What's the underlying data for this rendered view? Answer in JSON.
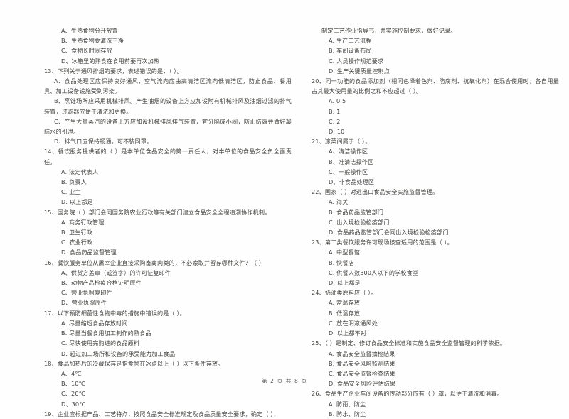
{
  "document": {
    "type": "scanned-exam-paper",
    "language": "zh-CN",
    "footer": "第 2 页 共 8 页",
    "page_number": 2,
    "total_pages": 8,
    "background_color": "#fefefe",
    "text_color": "#43423f"
  },
  "left_column": {
    "continued_options": [
      "A、生熟食物分开放置",
      "B、生熟食物要清洗干净",
      "C、食物长时间存放",
      "D、冰箱里的熟食在食用前要再次加热"
    ],
    "questions": [
      {
        "number": "13",
        "stem": "13、下列关于通风排烟的要求，表述错误的是：（        ）。",
        "options": [
          "A、食品处理区应保持良好通风，空气流向应由高清洁区流向低清洁区，防止食品、餐用具、加工设备设施受到污染。",
          "B、烹饪场所应采用机械排风。产生油烟的设备上方应加设附有机械排风及油烟过滤的排气装置，过滤器应便于清洗和更换。",
          "C、产生大量蒸汽的设备上方应加设机械排风排气装置，宜分隔成小间，防止结露并做好凝结水的引泄。",
          "D、排气口应保持畅通，可不装网罩。"
        ],
        "option_style": "paragraph"
      },
      {
        "number": "14",
        "stem": "14、餐饮服务提供者的（        ）是本单位食品安全的第一责任人，对本单位的食品安全负全面责任。",
        "options": [
          "A. 法定代表人",
          "B. 负责人",
          "C. 业主",
          "D. 以上都是"
        ],
        "option_style": "list"
      },
      {
        "number": "15",
        "stem": "15、国务院（        ）部门会同国务院农业行政等有关部门建立食品安全全程追溯协作机制。",
        "options": [
          "A. 商务行政管理",
          "B. 卫生行政",
          "C. 农业行政",
          "D. 食品药品监督管理"
        ],
        "option_style": "list"
      },
      {
        "number": "16",
        "stem": "16、餐饮服务单位从屠宰企业直接采购畜禽肉类的，不必索取并留存哪种文件？（        ）",
        "options": [
          "A、供货方盖章（或签字）的许可证复印件",
          "B、动物产品检疫合格证明原件",
          "C、营业执照复印件",
          "D、营业执照原件"
        ],
        "option_style": "list"
      },
      {
        "number": "17",
        "stem": "17、以下预防细菌性食物中毒的措施中错误的是（        ）。",
        "options": [
          "A. 尽量缩短食品存放时间",
          "B. 尽量当餐食用加工制作的熟食品",
          "C. 尽快使用完购进的食品原料",
          "D. 超过加工场所和设备的承受能力加工食品"
        ],
        "option_style": "list"
      },
      {
        "number": "18",
        "stem": "18、食品加热后的冷藏保存是指食物在冰点以上（        ）以下条件存放。",
        "options": [
          "A、4℃",
          "B、10℃",
          "C、20℃",
          "D、30℃"
        ],
        "option_style": "list"
      },
      {
        "number": "19",
        "stem": "19、企业应根据产品、工艺特点，按照食品安全标准规定及食品质量安全要求，确定（        ），",
        "options": [],
        "option_style": "list"
      }
    ]
  },
  "right_column": {
    "continued_stem": "制定工艺作业指导书，并实施控制要求，做好记录。",
    "continued_options": [
      "A. 生产工艺流程",
      "B. 车间设备布局",
      "C. 人员操作规范要求",
      "D. 生产关键质量控制点"
    ],
    "questions": [
      {
        "number": "20",
        "stem": "20、同一功能的食品添加剂（相同色泽着色剂、防腐剂、抗氧化剂）在混合使用时，各自用量占其最大使用量的比例之和不应超过（        ）。",
        "options": [
          "A. 0.5",
          "B. 1",
          "C. 2",
          "D. 10"
        ],
        "option_style": "list"
      },
      {
        "number": "21",
        "stem": "21、凉菜间属于（        ）。",
        "options": [
          "A、清洁操作区",
          "B、准清洁操作区",
          "C、一般操作区",
          "D、非食品处理区"
        ],
        "option_style": "list"
      },
      {
        "number": "22",
        "stem": "22、国家（        ）对进出口食品安全实施监督管理。",
        "options": [
          "A. 海关",
          "B. 食品药品监管部门",
          "C. 出入境检验检疫部门",
          "D. 食品药品监管部门会同出入境检验检疫部门"
        ],
        "option_style": "list"
      },
      {
        "number": "23",
        "stem": "23、第二类餐饮服务许可现场核查适用的范围是（        ）。",
        "options": [
          "A. 中型餐馆",
          "B. 快餐店",
          "C. 供餐人数300人以下的学校食堂",
          "D. 以上都是"
        ],
        "option_style": "list"
      },
      {
        "number": "24",
        "stem": "24、奶油类原料应（        ）。",
        "options": [
          "A. 常温存放",
          "B. 低温存放",
          "C. 放在阴凉通风处",
          "D. 以上都不对"
        ],
        "option_style": "list"
      },
      {
        "number": "25",
        "stem": "25、（        ）是制定、修订食品安全标准和实施食品安全监督管理的科学依据。",
        "options": [
          "A. 食品安全监督抽检结果",
          "B. 食品安全风险监测结果",
          "C. 食品安全监督检查结果",
          "D. 食品安全风险评估结果"
        ],
        "option_style": "list"
      },
      {
        "number": "26",
        "stem": "26、食品生产企业车间设备的传动部分应有（        ）罩，以便于清洗和消毒。",
        "options": [
          "A. 防雨、防尘",
          "B. 防水、防尘"
        ],
        "option_style": "list"
      }
    ]
  }
}
